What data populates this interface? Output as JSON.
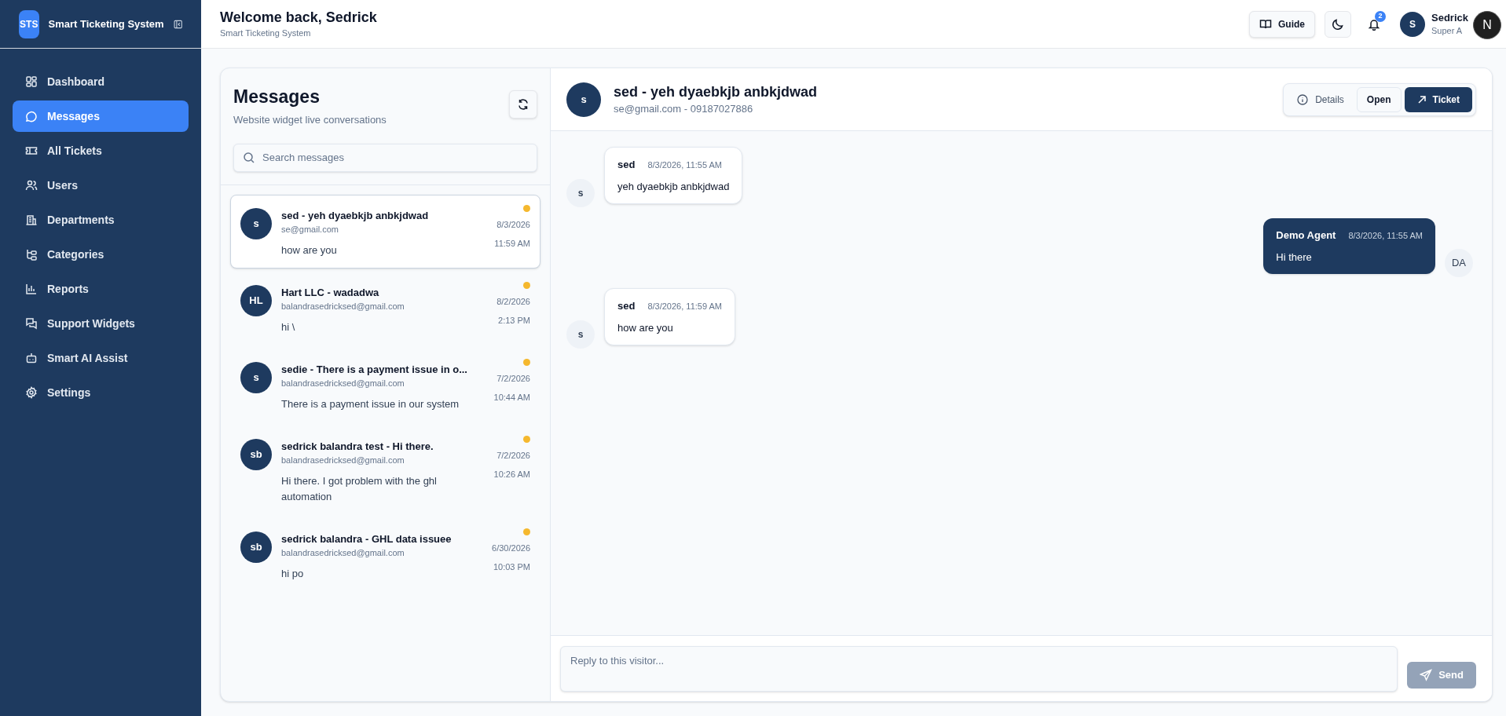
{
  "sidebar": {
    "logo": "STS",
    "app_name": "Smart Ticketing System",
    "items": [
      {
        "label": "Dashboard",
        "selected": false
      },
      {
        "label": "Messages",
        "selected": true
      },
      {
        "label": "All Tickets",
        "selected": false
      },
      {
        "label": "Users",
        "selected": false
      },
      {
        "label": "Departments",
        "selected": false
      },
      {
        "label": "Categories",
        "selected": false
      },
      {
        "label": "Reports",
        "selected": false
      },
      {
        "label": "Support Widgets",
        "selected": false
      },
      {
        "label": "Smart AI Assist",
        "selected": false
      },
      {
        "label": "Settings",
        "selected": false
      }
    ]
  },
  "header": {
    "title": "Welcome back, Sedrick",
    "subtitle": "Smart Ticketing System",
    "guide_button": "Guide",
    "notification_count": "2",
    "user": {
      "initial": "S",
      "name": "Sedrick",
      "role": "Super A"
    },
    "dev_badge": "N"
  },
  "conversation_list": {
    "title": "Messages",
    "subtitle": "Website widget live conversations",
    "search": {
      "placeholder": "Search messages"
    },
    "conversations": [
      {
        "initials": "s",
        "title": "sed - yeh dyaebkjb anbkjdwad",
        "email": "se@gmail.com",
        "preview": "how are you",
        "date": "8/3/2026",
        "time": "11:59 AM",
        "unread": true,
        "selected": true
      },
      {
        "initials": "HL",
        "title": "Hart LLC - wadadwa",
        "email": "balandrasedricksed@gmail.com",
        "preview": "hi \\",
        "date": "8/2/2026",
        "time": "2:13 PM",
        "unread": true,
        "selected": false
      },
      {
        "initials": "s",
        "title": "sedie - There is a payment issue in o...",
        "email": "balandrasedricksed@gmail.com",
        "preview": "There is a payment issue in our system",
        "date": "7/2/2026",
        "time": "10:44 AM",
        "unread": true,
        "selected": false
      },
      {
        "initials": "sb",
        "title": "sedrick balandra test - Hi there.",
        "email": "balandrasedricksed@gmail.com",
        "preview": "Hi there. I got problem with the ghl automation",
        "date": "7/2/2026",
        "time": "10:26 AM",
        "unread": true,
        "selected": false
      },
      {
        "initials": "sb",
        "title": "sedrick balandra - GHL data issuee",
        "email": "balandrasedricksed@gmail.com",
        "preview": "hi po",
        "date": "6/30/2026",
        "time": "10:03 PM",
        "unread": true,
        "selected": false
      }
    ]
  },
  "chat": {
    "initials": "s",
    "title": "sed - yeh dyaebkjb anbkjdwad",
    "contact": "se@gmail.com - 09187027886",
    "details_button": "Details",
    "status_button": "Open",
    "ticket_button": "Ticket",
    "messages": [
      {
        "kind": "visitor",
        "initials": "s",
        "sender": "sed",
        "time": "8/3/2026, 11:55 AM",
        "text": "yeh dyaebkjb anbkjdwad"
      },
      {
        "kind": "agent",
        "initials": "DA",
        "sender": "Demo Agent",
        "time": "8/3/2026, 11:55 AM",
        "text": "Hi there"
      },
      {
        "kind": "visitor",
        "initials": "s",
        "sender": "sed",
        "time": "8/3/2026, 11:59 AM",
        "text": "how are you"
      }
    ],
    "reply": {
      "placeholder": "Reply to this visitor..."
    },
    "send_button": {
      "label": "Send",
      "disabled": true
    }
  }
}
